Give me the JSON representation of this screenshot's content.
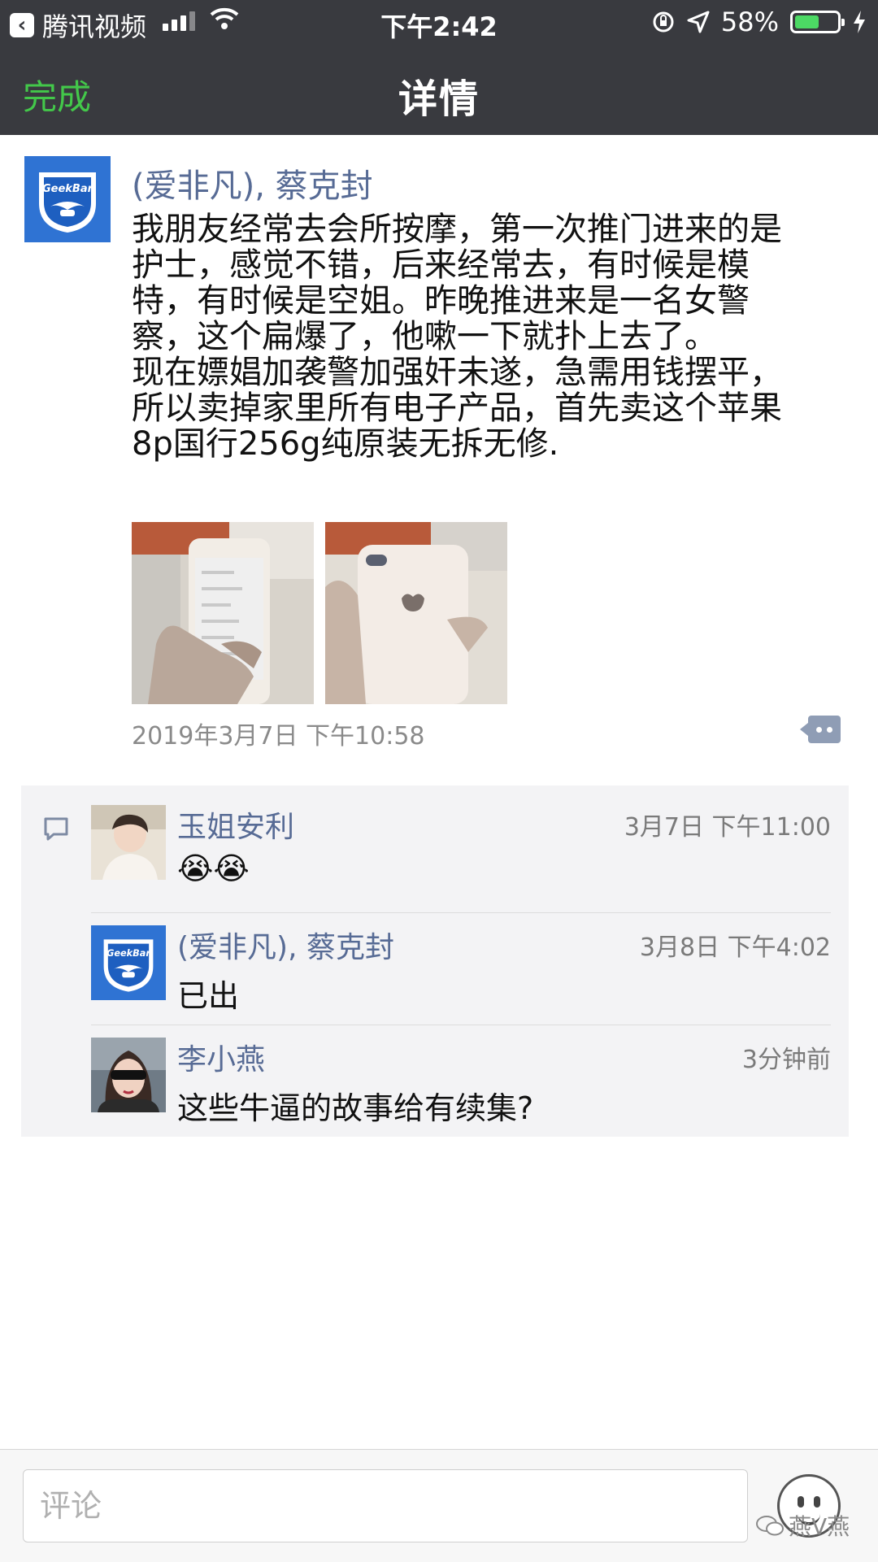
{
  "status_bar": {
    "back_app": "腾讯视频",
    "time": "下午2:42",
    "battery": "58%",
    "battery_level": 0.58
  },
  "nav": {
    "done": "完成",
    "title": "详情"
  },
  "post": {
    "author": "(爱非凡), 蔡克封",
    "avatar_logo": "GeekBar",
    "text": "我朋友经常去会所按摩，第一次推门进来的是\n护士，感觉不错，后来经常去，有时候是模\n特，有时候是空姐。昨晚推进来是一名女警\n察，这个扁爆了，他嗽一下就扑上去了。\n现在嫖娼加袭警加强奸未遂，急需用钱摆平，\n所以卖掉家里所有电子产品，首先卖这个苹果\n8p国行256g纯原装无拆无修.",
    "time": "2019年3月7日 下午10:58"
  },
  "comments": [
    {
      "name": "玉姐安利",
      "time": "3月7日 下午11:00",
      "text": "😭😭"
    },
    {
      "name": "(爱非凡), 蔡克封",
      "time": "3月8日 下午4:02",
      "text": "已出",
      "avatar_logo": "GeekBar"
    },
    {
      "name": "李小燕",
      "time": "3分钟前",
      "text": "这些牛逼的故事给有续集?"
    }
  ],
  "bottom": {
    "comment_placeholder": "评论",
    "watermark": "燕V燕"
  },
  "colors": {
    "nav_bg": "#393a3f",
    "done_green": "#43c84a",
    "link_blue": "#576b95",
    "comment_bg": "#f3f3f5"
  }
}
